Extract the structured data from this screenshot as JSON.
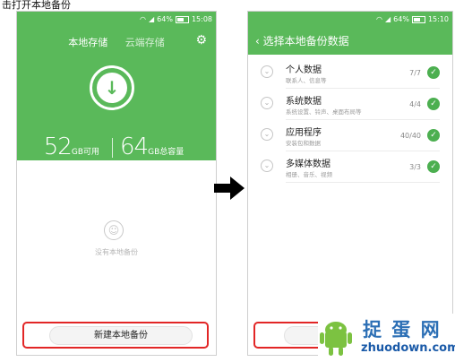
{
  "caption": "击打开本地备份",
  "phone1": {
    "status": {
      "battery": "64%",
      "time": "15:08"
    },
    "tabs": [
      "本地存储",
      "云端存储"
    ],
    "storage": {
      "available_num": "52",
      "available_unit": "GB可用",
      "total_num": "64",
      "total_unit": "GB总容量"
    },
    "empty_text": "没有本地备份",
    "new_backup_label": "新建本地备份"
  },
  "phone2": {
    "status": {
      "battery": "64%",
      "time": "15:10"
    },
    "back_label": "‹ 选择本地备份数据",
    "items": [
      {
        "name": "个人数据",
        "desc": "联系人、信息等",
        "count": "7/7"
      },
      {
        "name": "系统数据",
        "desc": "系统设置、铃声、桌面布局等",
        "count": "4/4"
      },
      {
        "name": "应用程序",
        "desc": "安装包和数据",
        "count": "40/40"
      },
      {
        "name": "多媒体数据",
        "desc": "相册、音乐、视频",
        "count": "3/3"
      }
    ]
  },
  "watermark": {
    "cn": "捉 蛋 网",
    "en": "zhuodown.com"
  },
  "colors": {
    "primary_green": "#5ab95a",
    "highlight_red": "#e22626",
    "check_green": "#4caf50"
  }
}
